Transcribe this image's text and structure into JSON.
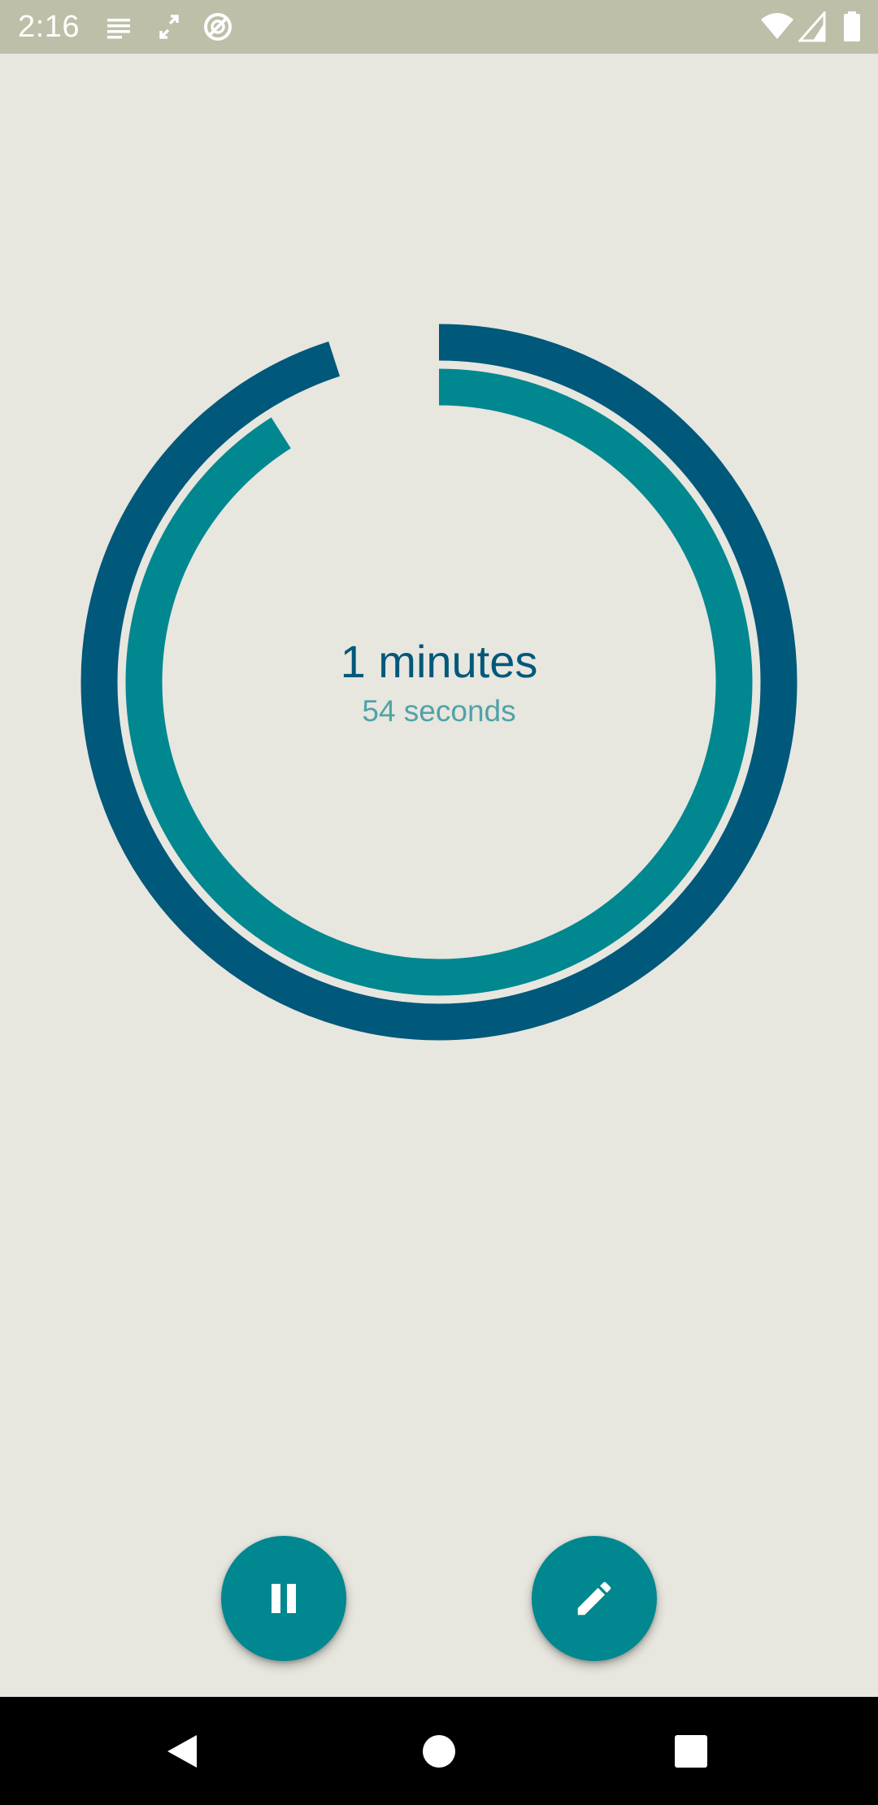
{
  "status_bar": {
    "time": "2:16",
    "left_icons": [
      "notes-icon",
      "expand-icon",
      "no-disturb-icon"
    ],
    "right_icons": [
      "wifi-icon",
      "signal-icon",
      "battery-icon"
    ]
  },
  "timer": {
    "primary_text": "1 minutes",
    "secondary_text": "54 seconds",
    "outer_ring_progress": 0.95,
    "inner_ring_progress": 0.91
  },
  "fabs": {
    "pause_icon": "pause-icon",
    "edit_icon": "pencil-icon"
  },
  "nav": {
    "icons": [
      "back-icon",
      "home-icon",
      "recents-icon"
    ]
  },
  "colors": {
    "background": "#E7E6DF",
    "status_bar": "#BEBFA8",
    "outer_ring": "#00587A",
    "inner_ring": "#00878F",
    "primary_text": "#00587A",
    "secondary_text": "#4FA3A7",
    "fab": "#00878F",
    "nav_bar": "#000000"
  }
}
